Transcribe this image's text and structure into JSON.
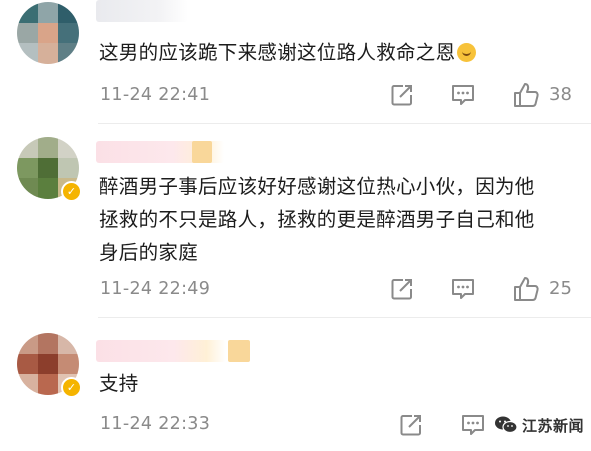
{
  "comments": [
    {
      "text": "这男的应该跪下来感谢这位路人救命之恩",
      "emoji_icon": "dog-face-emoji",
      "time": "11-24 22:41",
      "like_count": "38"
    },
    {
      "text_lines": [
        "醉酒男子事后应该好好感谢这位热心小伙，因为他",
        "拯救的不只是路人，拯救的更是醉酒男子自己和他",
        "身后的家庭"
      ],
      "time": "11-24 22:49",
      "like_count": "25"
    },
    {
      "text": "支持",
      "time": "11-24 22:33",
      "like_count": ""
    }
  ],
  "watermark": {
    "text": "江苏新闻"
  },
  "colors": {
    "meta": "#8a8a8a",
    "text": "#1c1c1c",
    "badge": "#f5b400"
  }
}
